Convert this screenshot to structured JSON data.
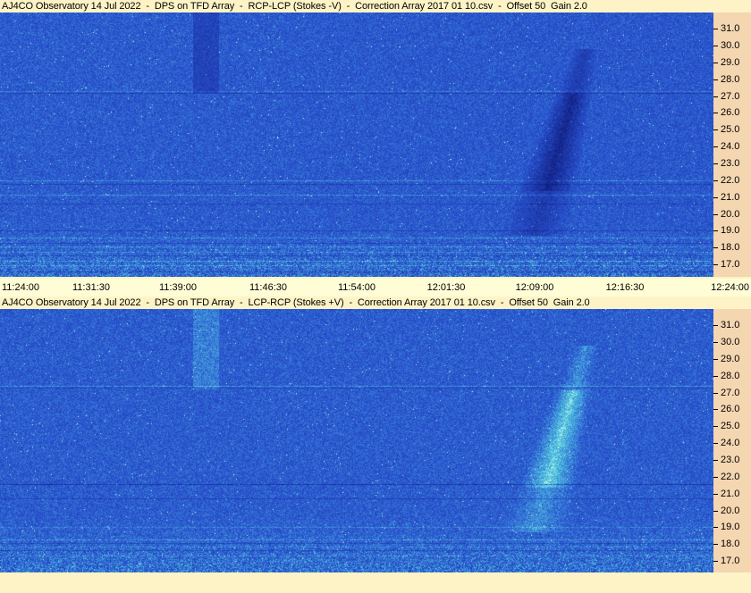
{
  "panels": [
    {
      "title": "AJ4CO Observatory 14 Jul 2022  -  DPS on TFD Array  -  RCP-LCP (Stokes -V)  -  Correction Array 2017 01 10.csv  -  Offset 50  Gain 2.0",
      "polarity": "negative"
    },
    {
      "title": "AJ4CO Observatory 14 Jul 2022  -  DPS on TFD Array  -  LCP-RCP (Stokes +V)  -  Correction Array 2017 01 10.csv  -  Offset 50  Gain 2.0",
      "polarity": "positive"
    }
  ],
  "frequency_ticks": [
    "31.0",
    "30.0",
    "29.0",
    "28.0",
    "27.0",
    "26.0",
    "25.0",
    "24.0",
    "23.0",
    "22.0",
    "21.0",
    "20.0",
    "19.0",
    "18.0",
    "17.0"
  ],
  "time_ticks": [
    "11:24:00",
    "11:31:30",
    "11:39:00",
    "11:46:30",
    "11:54:00",
    "12:01:30",
    "12:09:00",
    "12:16:30",
    "12:24:00"
  ],
  "colors": {
    "background": "#fdf3c6",
    "axis_panel": "#f4d6b0",
    "time_axis_background": "#fffdd6",
    "spectrogram_base": "#2a55d2"
  }
}
